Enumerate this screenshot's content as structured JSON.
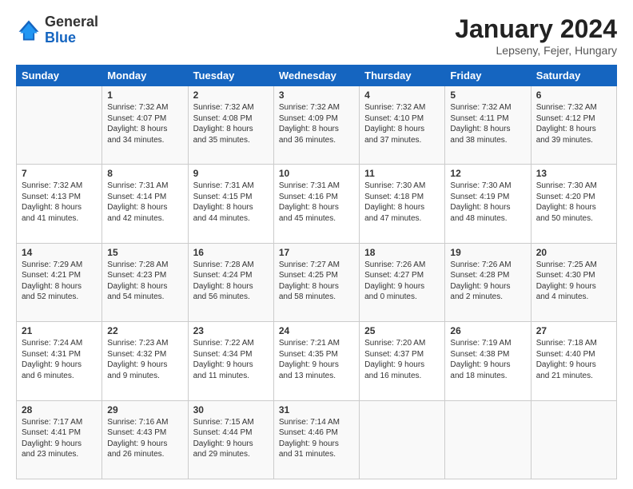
{
  "header": {
    "logo_general": "General",
    "logo_blue": "Blue",
    "month_title": "January 2024",
    "location": "Lepseny, Fejer, Hungary"
  },
  "days_of_week": [
    "Sunday",
    "Monday",
    "Tuesday",
    "Wednesday",
    "Thursday",
    "Friday",
    "Saturday"
  ],
  "weeks": [
    [
      {
        "day": "",
        "info": ""
      },
      {
        "day": "1",
        "info": "Sunrise: 7:32 AM\nSunset: 4:07 PM\nDaylight: 8 hours\nand 34 minutes."
      },
      {
        "day": "2",
        "info": "Sunrise: 7:32 AM\nSunset: 4:08 PM\nDaylight: 8 hours\nand 35 minutes."
      },
      {
        "day": "3",
        "info": "Sunrise: 7:32 AM\nSunset: 4:09 PM\nDaylight: 8 hours\nand 36 minutes."
      },
      {
        "day": "4",
        "info": "Sunrise: 7:32 AM\nSunset: 4:10 PM\nDaylight: 8 hours\nand 37 minutes."
      },
      {
        "day": "5",
        "info": "Sunrise: 7:32 AM\nSunset: 4:11 PM\nDaylight: 8 hours\nand 38 minutes."
      },
      {
        "day": "6",
        "info": "Sunrise: 7:32 AM\nSunset: 4:12 PM\nDaylight: 8 hours\nand 39 minutes."
      }
    ],
    [
      {
        "day": "7",
        "info": "Sunrise: 7:32 AM\nSunset: 4:13 PM\nDaylight: 8 hours\nand 41 minutes."
      },
      {
        "day": "8",
        "info": "Sunrise: 7:31 AM\nSunset: 4:14 PM\nDaylight: 8 hours\nand 42 minutes."
      },
      {
        "day": "9",
        "info": "Sunrise: 7:31 AM\nSunset: 4:15 PM\nDaylight: 8 hours\nand 44 minutes."
      },
      {
        "day": "10",
        "info": "Sunrise: 7:31 AM\nSunset: 4:16 PM\nDaylight: 8 hours\nand 45 minutes."
      },
      {
        "day": "11",
        "info": "Sunrise: 7:30 AM\nSunset: 4:18 PM\nDaylight: 8 hours\nand 47 minutes."
      },
      {
        "day": "12",
        "info": "Sunrise: 7:30 AM\nSunset: 4:19 PM\nDaylight: 8 hours\nand 48 minutes."
      },
      {
        "day": "13",
        "info": "Sunrise: 7:30 AM\nSunset: 4:20 PM\nDaylight: 8 hours\nand 50 minutes."
      }
    ],
    [
      {
        "day": "14",
        "info": "Sunrise: 7:29 AM\nSunset: 4:21 PM\nDaylight: 8 hours\nand 52 minutes."
      },
      {
        "day": "15",
        "info": "Sunrise: 7:28 AM\nSunset: 4:23 PM\nDaylight: 8 hours\nand 54 minutes."
      },
      {
        "day": "16",
        "info": "Sunrise: 7:28 AM\nSunset: 4:24 PM\nDaylight: 8 hours\nand 56 minutes."
      },
      {
        "day": "17",
        "info": "Sunrise: 7:27 AM\nSunset: 4:25 PM\nDaylight: 8 hours\nand 58 minutes."
      },
      {
        "day": "18",
        "info": "Sunrise: 7:26 AM\nSunset: 4:27 PM\nDaylight: 9 hours\nand 0 minutes."
      },
      {
        "day": "19",
        "info": "Sunrise: 7:26 AM\nSunset: 4:28 PM\nDaylight: 9 hours\nand 2 minutes."
      },
      {
        "day": "20",
        "info": "Sunrise: 7:25 AM\nSunset: 4:30 PM\nDaylight: 9 hours\nand 4 minutes."
      }
    ],
    [
      {
        "day": "21",
        "info": "Sunrise: 7:24 AM\nSunset: 4:31 PM\nDaylight: 9 hours\nand 6 minutes."
      },
      {
        "day": "22",
        "info": "Sunrise: 7:23 AM\nSunset: 4:32 PM\nDaylight: 9 hours\nand 9 minutes."
      },
      {
        "day": "23",
        "info": "Sunrise: 7:22 AM\nSunset: 4:34 PM\nDaylight: 9 hours\nand 11 minutes."
      },
      {
        "day": "24",
        "info": "Sunrise: 7:21 AM\nSunset: 4:35 PM\nDaylight: 9 hours\nand 13 minutes."
      },
      {
        "day": "25",
        "info": "Sunrise: 7:20 AM\nSunset: 4:37 PM\nDaylight: 9 hours\nand 16 minutes."
      },
      {
        "day": "26",
        "info": "Sunrise: 7:19 AM\nSunset: 4:38 PM\nDaylight: 9 hours\nand 18 minutes."
      },
      {
        "day": "27",
        "info": "Sunrise: 7:18 AM\nSunset: 4:40 PM\nDaylight: 9 hours\nand 21 minutes."
      }
    ],
    [
      {
        "day": "28",
        "info": "Sunrise: 7:17 AM\nSunset: 4:41 PM\nDaylight: 9 hours\nand 23 minutes."
      },
      {
        "day": "29",
        "info": "Sunrise: 7:16 AM\nSunset: 4:43 PM\nDaylight: 9 hours\nand 26 minutes."
      },
      {
        "day": "30",
        "info": "Sunrise: 7:15 AM\nSunset: 4:44 PM\nDaylight: 9 hours\nand 29 minutes."
      },
      {
        "day": "31",
        "info": "Sunrise: 7:14 AM\nSunset: 4:46 PM\nDaylight: 9 hours\nand 31 minutes."
      },
      {
        "day": "",
        "info": ""
      },
      {
        "day": "",
        "info": ""
      },
      {
        "day": "",
        "info": ""
      }
    ]
  ]
}
